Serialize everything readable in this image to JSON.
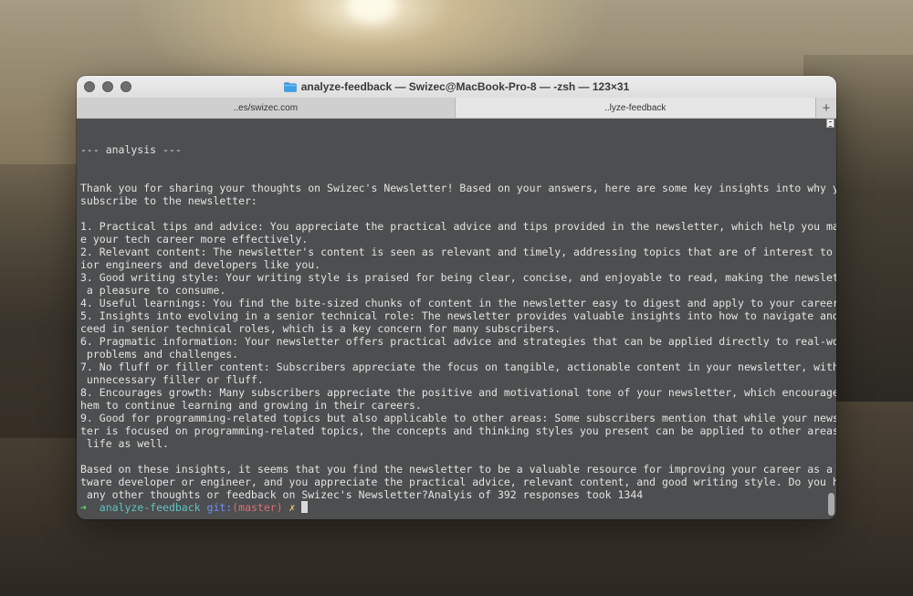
{
  "window": {
    "title": "analyze-feedback — Swizec@MacBook-Pro-8 — -zsh — 123×31"
  },
  "tabs": [
    {
      "label": "..es/swizec.com"
    },
    {
      "label": "..lyze-feedback"
    }
  ],
  "new_tab_label": "+",
  "terminal": {
    "output": "--- analysis ---\n\n\nThank you for sharing your thoughts on Swizec's Newsletter! Based on your answers, here are some key insights into why you\nsubscribe to the newsletter:\n\n1. Practical tips and advice: You appreciate the practical advice and tips provided in the newsletter, which help you manag\ne your tech career more effectively.\n2. Relevant content: The newsletter's content is seen as relevant and timely, addressing topics that are of interest to sen\nior engineers and developers like you.\n3. Good writing style: Your writing style is praised for being clear, concise, and enjoyable to read, making the newsletter\n a pleasure to consume.\n4. Useful learnings: You find the bite-sized chunks of content in the newsletter easy to digest and apply to your career.\n5. Insights into evolving in a senior technical role: The newsletter provides valuable insights into how to navigate and su\nceed in senior technical roles, which is a key concern for many subscribers.\n6. Pragmatic information: Your newsletter offers practical advice and strategies that can be applied directly to real-world\n problems and challenges.\n7. No fluff or filler content: Subscribers appreciate the focus on tangible, actionable content in your newsletter, with no\n unnecessary filler or fluff.\n8. Encourages growth: Many subscribers appreciate the positive and motivational tone of your newsletter, which encourages t\nhem to continue learning and growing in their careers.\n9. Good for programming-related topics but also applicable to other areas: Some subscribers mention that while your newslet\nter is focused on programming-related topics, the concepts and thinking styles you present can be applied to other areas of\n life as well.\n\nBased on these insights, it seems that you find the newsletter to be a valuable resource for improving your career as a sof\ntware developer or engineer, and you appreciate the practical advice, relevant content, and good writing style. Do you have\n any other thoughts or feedback on Swizec's Newsletter?Analyis of 392 responses took 1344",
    "prompt": {
      "arrow": "➜",
      "directory": "analyze-feedback",
      "git_label": "git:",
      "branch": "(master)",
      "dirty_mark": "✗"
    }
  },
  "icons": {
    "title_icon": "folder-icon"
  },
  "colors": {
    "terminal_bg": "#4d4e4f",
    "terminal_fg": "#e3e3e3",
    "prompt_arrow": "#5bd36a",
    "prompt_dir": "#5ec3c6",
    "prompt_branch": "#e06c75"
  }
}
